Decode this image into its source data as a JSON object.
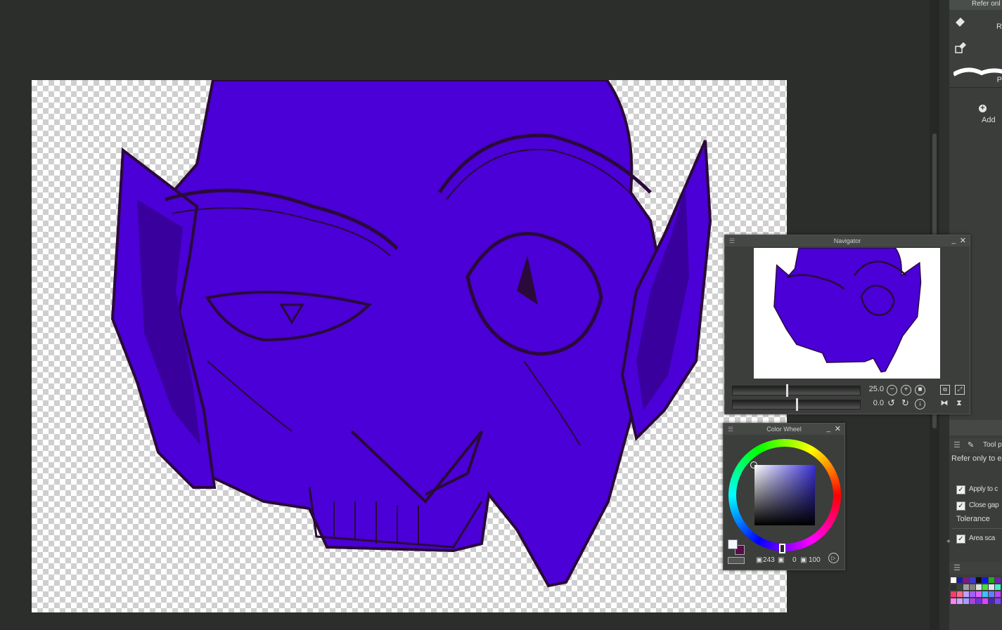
{
  "navigator": {
    "title": "Navigator",
    "zoom": "25.0",
    "rotation": "0.0"
  },
  "color_wheel": {
    "title": "Color Wheel",
    "h": "243",
    "s": "0",
    "v": "100"
  },
  "right_panel": {
    "top_label": "Refer onl",
    "tool1_label": "R",
    "tool3_label": "P",
    "add_label": "Add",
    "tool_prop_tab": "Tool p",
    "refer_text": "Refer only to ed",
    "apply_label": "Apply to c",
    "close_gap_label": "Close gap",
    "tolerance_label": "Tolerance",
    "area_scale_label": "Area sca"
  },
  "colors": {
    "face": "#4a00d6",
    "face_shadow": "#3a009e",
    "line": "#2a0a3a",
    "panel_bg": "#3b3e3b",
    "app_bg": "#2b2e2b"
  },
  "icons": {
    "fill": "paint-bucket-icon",
    "refer": "layer-reference-icon",
    "brush": "brush-stroke-icon",
    "add": "plus-circle-icon",
    "zoom_out": "minus-circle-icon",
    "zoom_in": "plus-circle-icon",
    "rotate_left": "rotate-left-icon",
    "rotate_right": "rotate-right-icon",
    "flip": "flip-horizontal-icon"
  }
}
